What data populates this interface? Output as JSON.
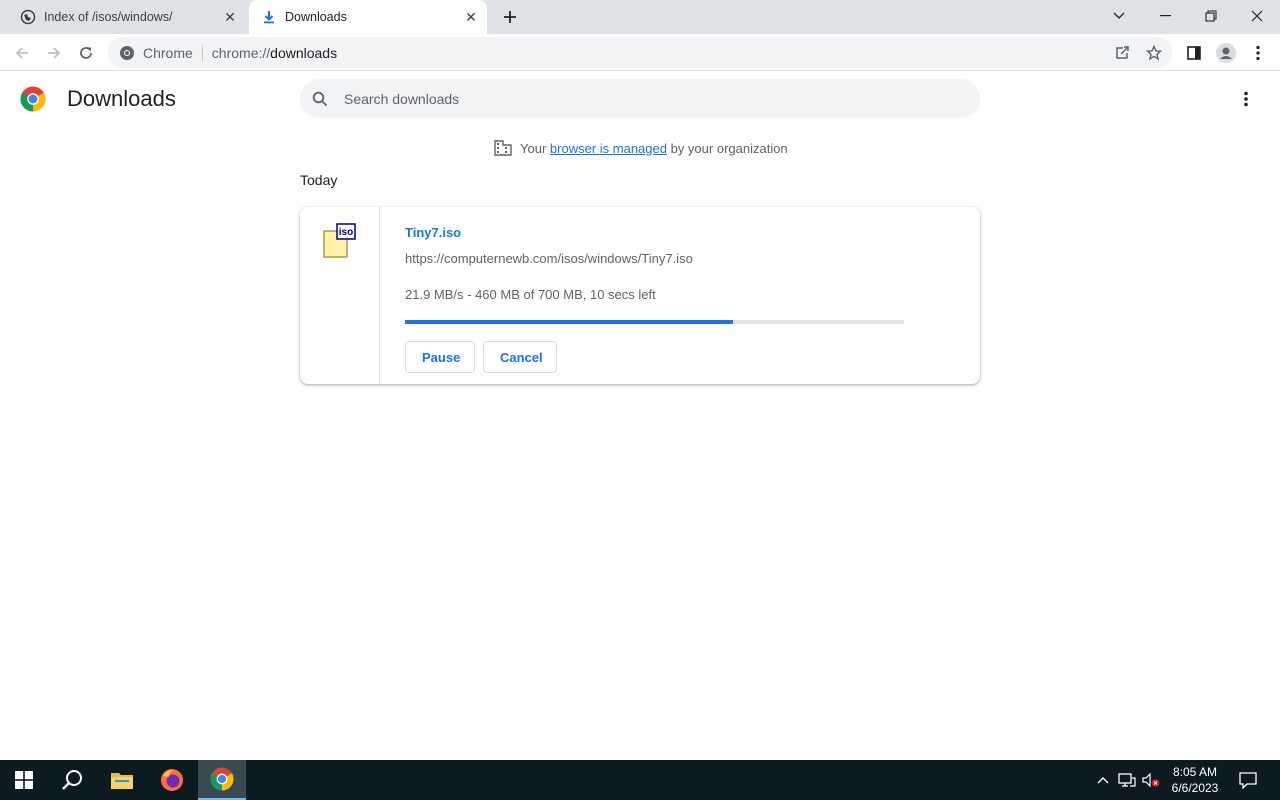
{
  "browser": {
    "tabs": [
      {
        "title": "Index of /isos/windows/",
        "icon": "web-page-icon",
        "active": false
      },
      {
        "title": "Downloads",
        "icon": "download-icon",
        "active": true
      }
    ],
    "omnibox": {
      "site_label": "Chrome",
      "url_scheme": "chrome://",
      "url_host": "downloads"
    }
  },
  "page": {
    "title": "Downloads",
    "search_placeholder": "Search downloads",
    "managed_notice": {
      "prefix": "Your",
      "link": "browser is managed",
      "suffix": "by your organization"
    },
    "section_label": "Today"
  },
  "download": {
    "filename": "Tiny7.iso",
    "url": "https://computernewb.com/isos/windows/Tiny7.iso",
    "status": "21.9 MB/s - 460 MB of 700 MB, 10 secs left",
    "progress_fraction": 0.657,
    "pause_label": "Pause",
    "cancel_label": "Cancel",
    "file_icon_label": "iso"
  },
  "taskbar": {
    "time": "8:05 AM",
    "date": "6/6/2023"
  },
  "colors": {
    "accent": "#1a73e8",
    "taskbar": "#0c1a22"
  }
}
